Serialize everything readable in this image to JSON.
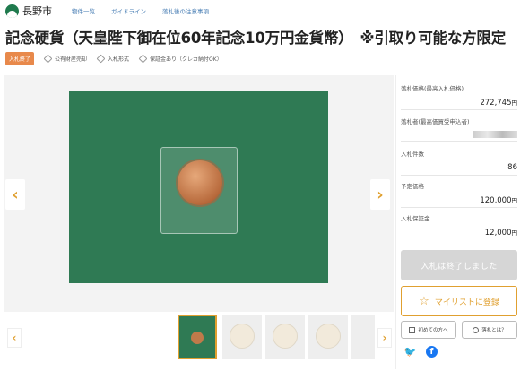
{
  "header": {
    "site_name": "長野市",
    "nav": [
      "物件一覧",
      "ガイドライン",
      "落札後の注意事項"
    ]
  },
  "title": "記念硬貨（天皇陛下御在位60年記念10万円金貨幣）　※引取り可能な方限定",
  "tags": {
    "status": "入札終了",
    "items": [
      "公有財産売却",
      "入札形式",
      "保証金あり（クレカ納付OK）"
    ]
  },
  "gallery": {
    "prev_symbol": "‹",
    "next_symbol": "›"
  },
  "info": {
    "winning_price_label": "落札価格(最高入札価格)",
    "winning_price": "272,745",
    "winner_label": "落札者(最高価買受申込者)",
    "bid_count_label": "入札件数",
    "bid_count": "86",
    "estimated_price_label": "予定価格",
    "estimated_price": "120,000",
    "deposit_label": "入札保証金",
    "deposit": "12,000",
    "yen": "円"
  },
  "actions": {
    "ended_label": "入札は終了しました",
    "mylist_label": "マイリストに登録",
    "beginner_label": "初めての方へ",
    "what_is_auction_label": "落札とは？"
  },
  "colors": {
    "accent": "#e0a030",
    "status_badge": "#e8894b",
    "logo": "#1f7a4d",
    "image_bg": "#2f7a54"
  }
}
